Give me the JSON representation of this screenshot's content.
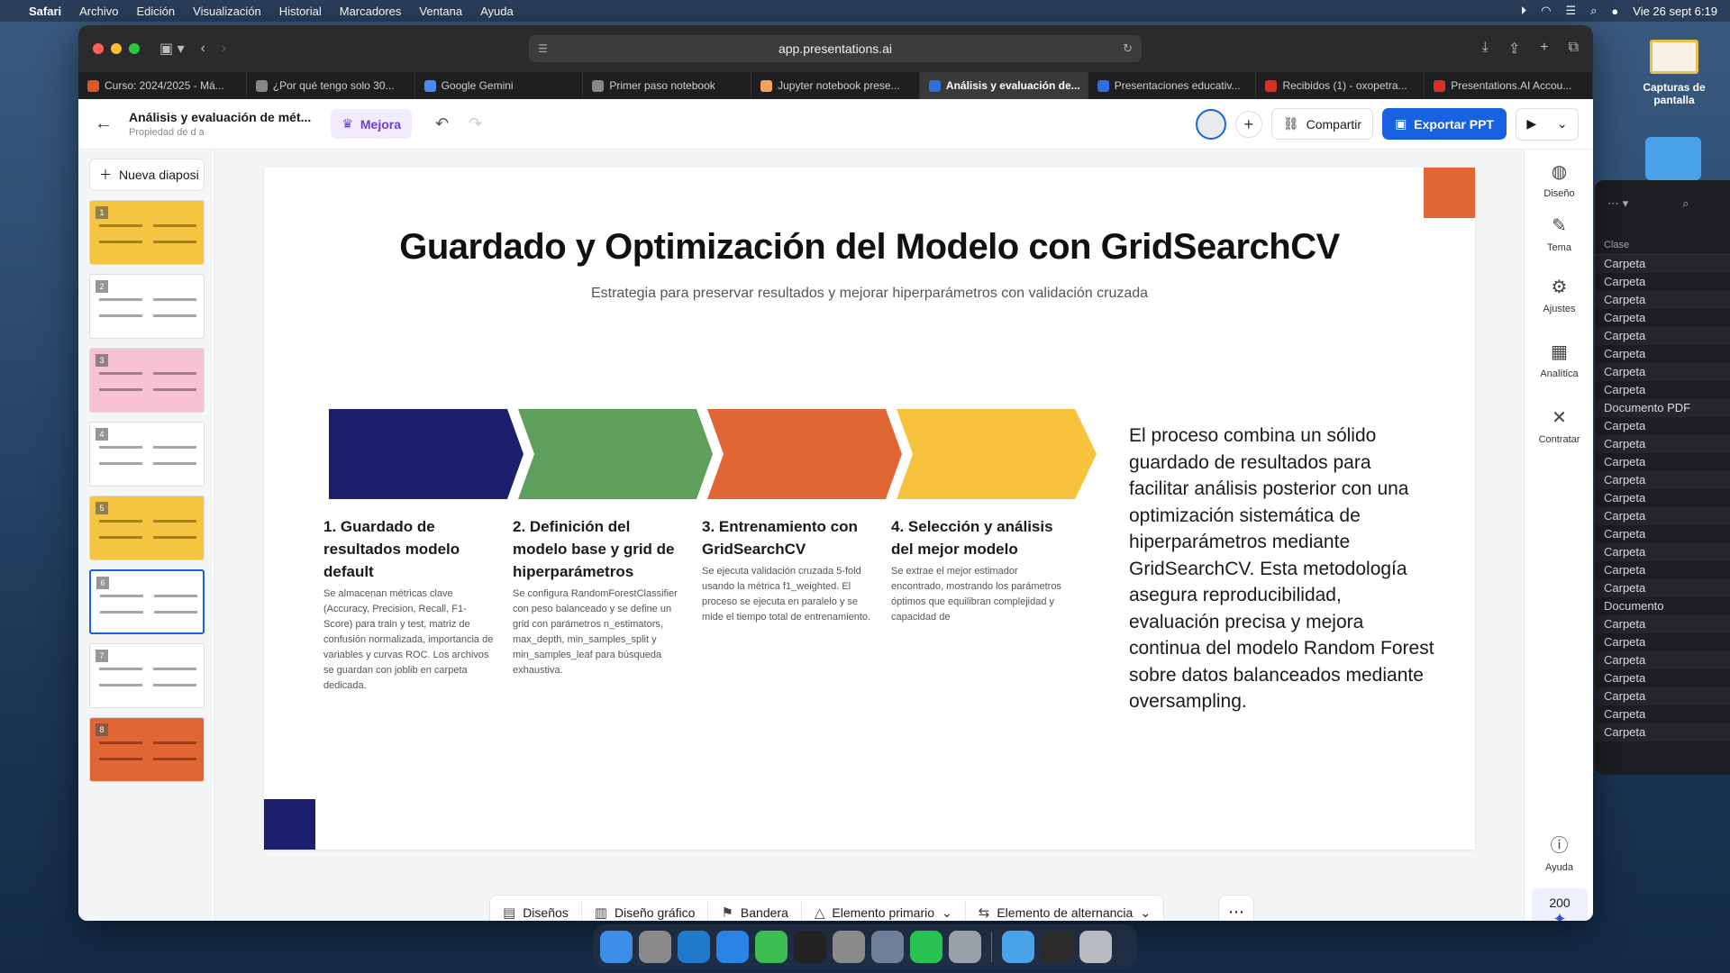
{
  "menubar": {
    "app": "Safari",
    "items": [
      "Archivo",
      "Edición",
      "Visualización",
      "Historial",
      "Marcadores",
      "Ventana",
      "Ayuda"
    ],
    "clock": "Vie 26 sept 6:19"
  },
  "desktop": {
    "screenshots_label": "Capturas de pantalla"
  },
  "browser": {
    "url": "app.presentations.ai",
    "tabs": [
      {
        "label": "Curso: 2024/2025 - Má...",
        "color": "#e0562b"
      },
      {
        "label": "¿Por qué tengo solo 30...",
        "color": "#888888"
      },
      {
        "label": "Google Gemini",
        "color": "#4a8af4"
      },
      {
        "label": "Primer paso notebook",
        "color": "#888888"
      },
      {
        "label": "Jupyter notebook prese...",
        "color": "#f3a261"
      },
      {
        "label": "Análisis y evaluación de...",
        "color": "#2f6de0"
      },
      {
        "label": "Presentaciones educativ...",
        "color": "#2f6de0"
      },
      {
        "label": "Recibidos (1) - oxopetra...",
        "color": "#d93025"
      },
      {
        "label": "Presentations.AI Accou...",
        "color": "#d93025"
      }
    ],
    "active_tab": 5
  },
  "header": {
    "doc_title": "Análisis y evaluación de mét...",
    "doc_sub": "Propiedad de d a",
    "mejora_label": "Mejora",
    "share_label": "Compartir",
    "export_label": "Exportar PPT"
  },
  "sidebar": {
    "new_slide_label": "Nueva diaposi",
    "slides": [
      {
        "num": "1",
        "bg": "#f5c542"
      },
      {
        "num": "2",
        "bg": "#ffffff"
      },
      {
        "num": "3",
        "bg": "#f7c3d2"
      },
      {
        "num": "4",
        "bg": "#ffffff"
      },
      {
        "num": "5",
        "bg": "#f5c542"
      },
      {
        "num": "6",
        "bg": "#ffffff"
      },
      {
        "num": "7",
        "bg": "#ffffff"
      },
      {
        "num": "8",
        "bg": "#e06635"
      }
    ],
    "selected": 5
  },
  "slide": {
    "title": "Guardado y Optimización del Modelo con GridSearchCV",
    "subtitle": "Estrategia para preservar resultados y mejorar hiperparámetros con validación cruzada",
    "colors": [
      "#1c1f6b",
      "#5e9f5e",
      "#e06635",
      "#f7c23c"
    ],
    "steps": [
      {
        "title": "1. Guardado de resultados modelo default",
        "text": "Se almacenan métricas clave (Accuracy, Precision, Recall, F1-Score) para train y test, matriz de confusión normalizada, importancia de variables y curvas ROC. Los archivos se guardan con joblib en carpeta dedicada."
      },
      {
        "title": "2. Definición del modelo base y grid de hiperparámetros",
        "text": "Se configura RandomForestClassifier con peso balanceado y se define un grid con parámetros n_estimators, max_depth, min_samples_split y min_samples_leaf para búsqueda exhaustiva."
      },
      {
        "title": "3. Entrenamiento con GridSearchCV",
        "text": "Se ejecuta validación cruzada 5-fold usando la métrica f1_weighted. El proceso se ejecuta en paralelo y se mide el tiempo total de entrenamiento."
      },
      {
        "title": "4. Selección y análisis del mejor modelo",
        "text": "Se extrae el mejor estimador encontrado, mostrando los parámetros óptimos que equilibran complejidad y capacidad de"
      }
    ],
    "body": "El proceso combina un sólido guardado de resultados para facilitar análisis posterior con una optimización sistemática de hiperparámetros mediante GridSearchCV. Esta metodología asegura reproducibilidad, evaluación precisa y mejora continua del modelo Random Forest sobre datos balanceados mediante oversampling."
  },
  "rail": {
    "items": [
      "Diseño",
      "Tema",
      "Ajustes",
      "Analítica",
      "Contratar"
    ],
    "help": "Ayuda",
    "credits": "200"
  },
  "toolbar": {
    "items": [
      "Diseños",
      "Diseño gráfico",
      "Bandera",
      "Elemento primario",
      "Elemento de alternancia"
    ]
  },
  "finder": {
    "column": "Clase",
    "rows": [
      "Carpeta",
      "Carpeta",
      "Carpeta",
      "Carpeta",
      "Carpeta",
      "Carpeta",
      "Carpeta",
      "Carpeta",
      "Documento PDF",
      "Carpeta",
      "Carpeta",
      "Carpeta",
      "Carpeta",
      "Carpeta",
      "Carpeta",
      "Carpeta",
      "Carpeta",
      "Carpeta",
      "Carpeta",
      "Documento",
      "Carpeta",
      "Carpeta",
      "Carpeta",
      "Carpeta",
      "Carpeta",
      "Carpeta",
      "Carpeta"
    ]
  },
  "dock": {
    "apps": [
      "finder",
      "launchpad",
      "vscode",
      "safari",
      "facetime",
      "terminal",
      "settings",
      "preview",
      "whatsapp",
      "tex",
      "downloads",
      "terminal2",
      "trash"
    ],
    "app_colors": [
      "#3d8ee8",
      "#8a8a8a",
      "#1f7acc",
      "#2a84e8",
      "#3cbd4f",
      "#222222",
      "#8a8a8a",
      "#6f7f99",
      "#27c252",
      "#9aa0a8",
      "#4aa3e8",
      "#2a2a2a",
      "#b8bcc2"
    ]
  }
}
